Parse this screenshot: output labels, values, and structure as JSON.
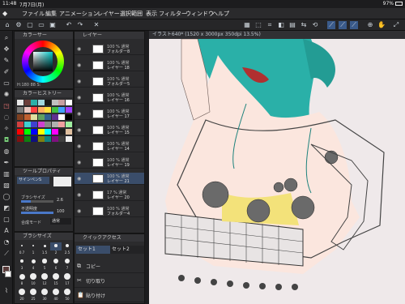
{
  "status": {
    "time": "11:48",
    "date": "7月7日(月)",
    "battery": "97%"
  },
  "menu": [
    "ファイル",
    "編集",
    "アニメーション",
    "レイヤー",
    "選択範囲",
    "表示",
    "フィルター",
    "ウィンドウ",
    "ヘルプ"
  ],
  "document": {
    "tab_title": "イラスト640* (1520 x 3000px 350dpi 13.5%)"
  },
  "color_panel": {
    "title": "カラーサー",
    "hsv": "H:180 88 S:",
    "history_title": "カラーヒストリー"
  },
  "tool_property": {
    "title": "ツールプロパティ",
    "tool": "サインペンS",
    "brush_size_label": "ブラシサイズ",
    "brush_size_value": "2.6",
    "opacity_label": "不透明度",
    "opacity_value": "100",
    "blend_label": "合成モード",
    "blend_value": "通常"
  },
  "brush_size_panel": {
    "title": "ブラシサイズ",
    "sizes": [
      "0.7",
      "1",
      "1.5",
      "2",
      "2.5",
      "3",
      "4",
      "5",
      "6",
      "7",
      "8",
      "10",
      "12",
      "15",
      "17",
      "20",
      "25",
      "30",
      "40",
      "50"
    ]
  },
  "layer_panel": {
    "title": "レイヤー",
    "layers": [
      {
        "mode": "100 % 通常",
        "name": "フォルダー8",
        "folder": true
      },
      {
        "mode": "100 % 通常",
        "name": "レイヤー 18",
        "folder": false
      },
      {
        "mode": "100 % 通常",
        "name": "フォルダー5",
        "folder": true
      },
      {
        "mode": "100 % 通常",
        "name": "レイヤー 16",
        "folder": false
      },
      {
        "mode": "100 % 通常",
        "name": "レイヤー 17",
        "folder": false
      },
      {
        "mode": "100 % 通常",
        "name": "レイヤー 15",
        "folder": false
      },
      {
        "mode": "100 % 通常",
        "name": "レイヤー 14",
        "folder": false
      },
      {
        "mode": "100 % 通常",
        "name": "レイヤー 19",
        "folder": false
      },
      {
        "mode": "100 % 通常",
        "name": "レイヤー 21",
        "folder": false
      },
      {
        "mode": "17 % 通常",
        "name": "レイヤー 20",
        "folder": false
      },
      {
        "mode": "100 % 通常",
        "name": "フォルダー4",
        "folder": true
      }
    ]
  },
  "quick_access": {
    "title": "クイックアクセス",
    "sets": [
      "セット1",
      "セット2"
    ],
    "items": [
      "コピー",
      "切り取り",
      "貼り付け"
    ]
  },
  "colors": {
    "accent": "#4a78c8",
    "hair": "#2ab0a8",
    "bg": "#efe9ea"
  }
}
